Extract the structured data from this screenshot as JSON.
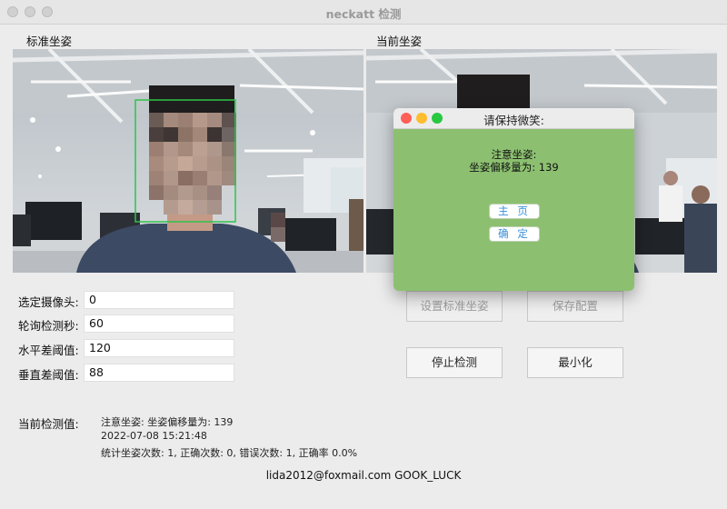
{
  "window": {
    "title": "neckatt 检测"
  },
  "panels": {
    "standard_label": "标准坐姿",
    "current_label": "当前坐姿"
  },
  "form": {
    "camera_label": "选定摄像头:",
    "camera_value": "0",
    "poll_label": "轮询检测秒:",
    "poll_value": "60",
    "horizontal_label": "水平差阈值:",
    "horizontal_value": "120",
    "vertical_label": "垂直差阈值:",
    "vertical_value": "88"
  },
  "buttons": {
    "set_standard": "设置标准坐姿",
    "save_config": "保存配置",
    "stop_detect": "停止检测",
    "minimize": "最小化"
  },
  "status": {
    "label": "当前检测值:",
    "line1": "注意坐姿: 坐姿偏移量为: 139",
    "line2": "2022-07-08 15:21:48",
    "line3": "统计坐姿次数: 1, 正确次数: 0, 错误次数: 1, 正确率 0.0%"
  },
  "dialog": {
    "title": "请保持微笑:",
    "line1": "注意坐姿:",
    "line2": "坐姿偏移量为: 139",
    "home_button": "主 页",
    "ok_button": "确 定"
  },
  "footer": "lida2012@foxmail.com GOOK_LUCK",
  "colors": {
    "dialog_bg": "#8cc070",
    "face_box": "#2fc34a",
    "link_blue": "#3a8fd8"
  }
}
